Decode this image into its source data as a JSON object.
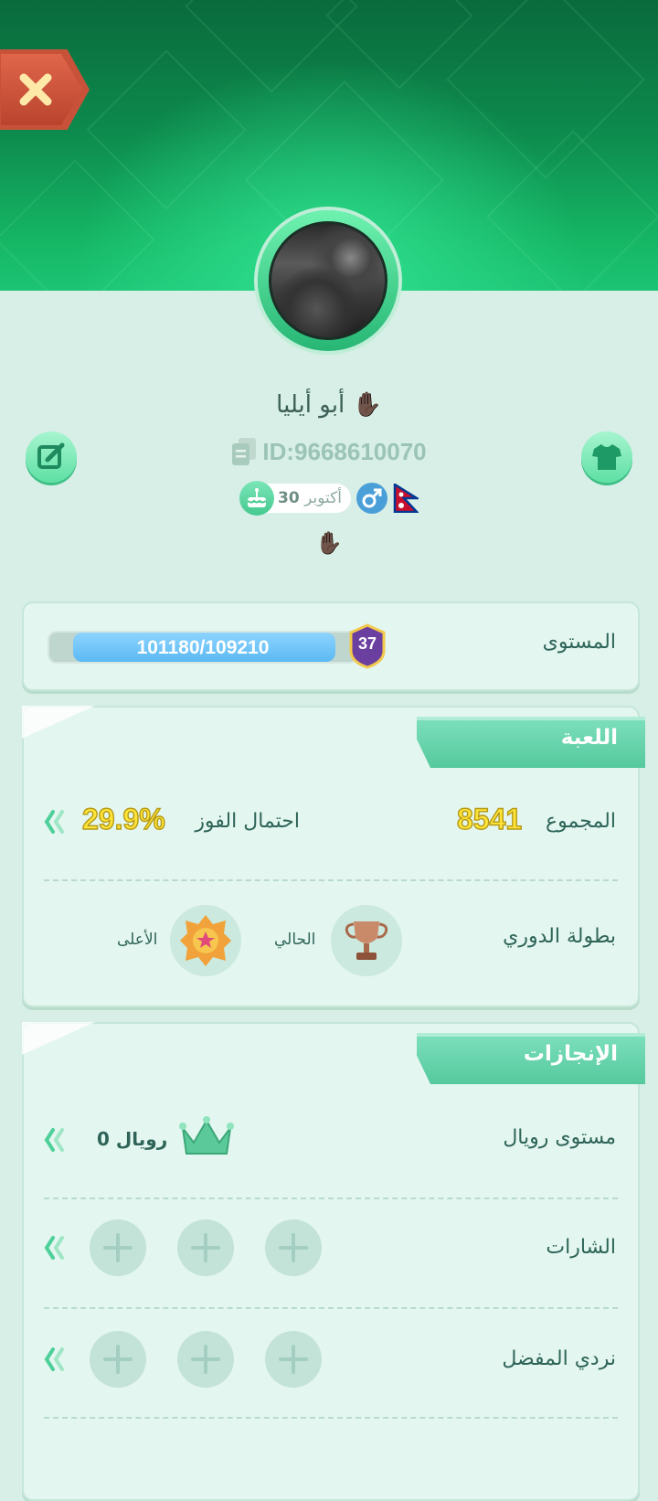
{
  "profile": {
    "name": "أبو أيليا",
    "id_text": "ID:9668610070",
    "birthday_day": "30",
    "birthday_month": "أكتوبر",
    "status_emoji": "✋🏿"
  },
  "level": {
    "label": "المستوى",
    "badge_number": "37",
    "progress_text": "101180/109210",
    "progress_fraction": 0.926
  },
  "game_section": {
    "title": "اللعبة",
    "total_label": "المجموع",
    "total_value": "8541",
    "win_rate_label": "احتمال الفوز",
    "win_rate_value": "29.9%",
    "league_label": "بطولة الدوري",
    "current_label": "الحالي",
    "highest_label": "الأعلى"
  },
  "achievements": {
    "title": "الإنجازات",
    "royal_level_label": "مستوى رويال",
    "royal_value": "0",
    "royal_word": "رويال",
    "badges_label": "الشارات",
    "favorite_dice_label": "نردي المفضل"
  },
  "icons": {
    "close": "close-icon",
    "edit": "edit-icon",
    "outfit": "shirt-icon",
    "copy": "copy-icon",
    "cake": "cake-icon",
    "gender": "male-icon",
    "flag": "nepal-flag-icon",
    "chevron": "double-chevron-left-icon",
    "crown": "crown-icon",
    "trophy": "trophy-icon",
    "add": "plus-icon"
  },
  "colors": {
    "header_green": "#16b866",
    "accent_mint": "#5ee0a4",
    "stat_yellow": "#ffe43a",
    "progress_blue": "#5bb9f2",
    "close_red": "#c85239",
    "text_teal": "#2e6458"
  }
}
